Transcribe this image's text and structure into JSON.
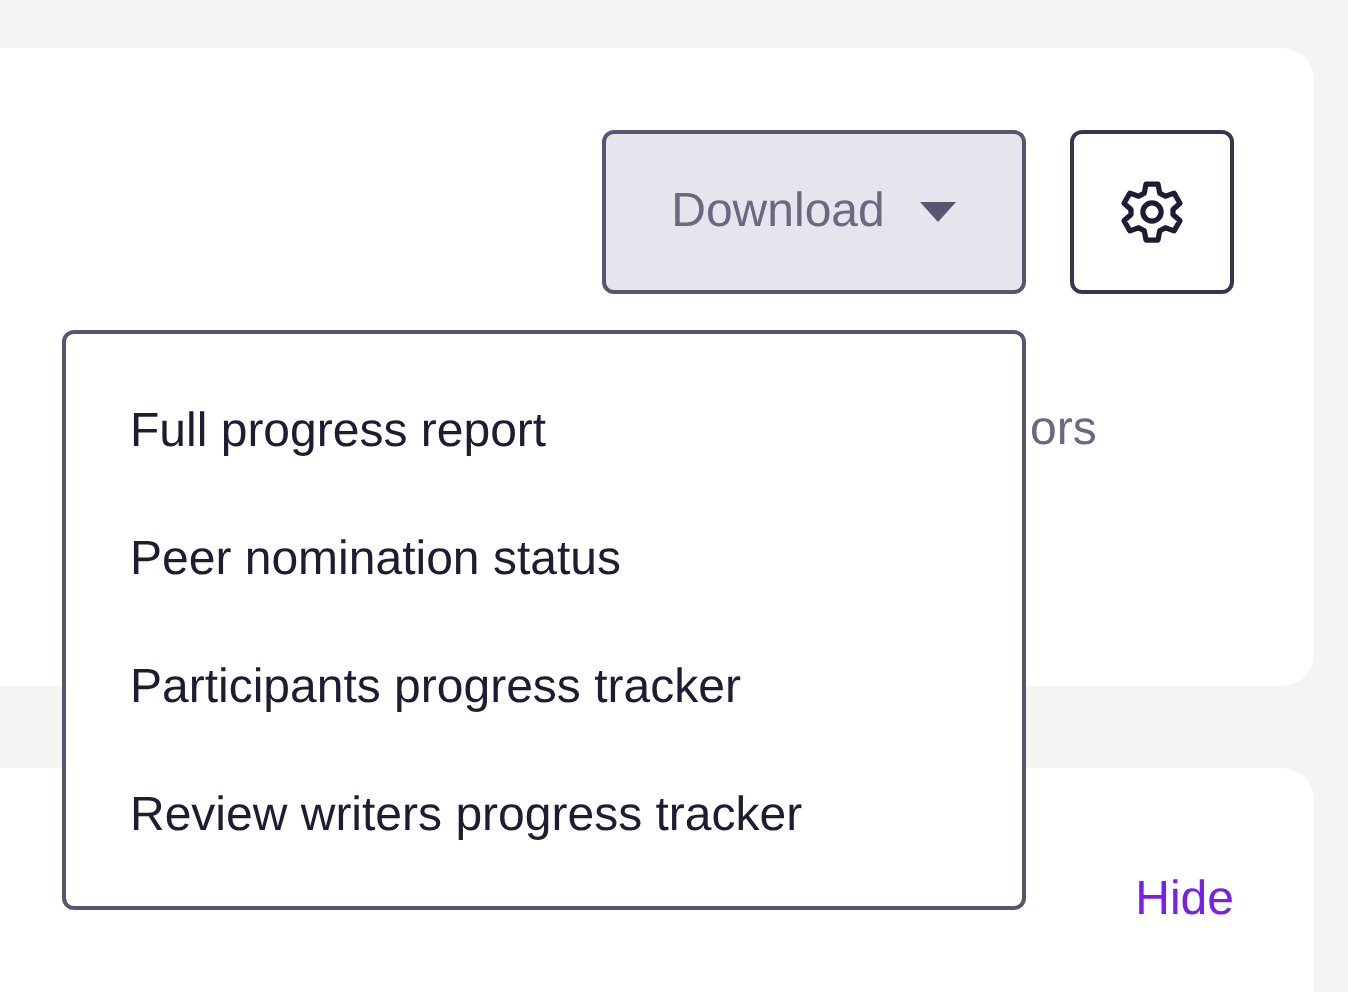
{
  "toolbar": {
    "download_button": {
      "label": "Download"
    }
  },
  "card_text": "ors",
  "download_menu": {
    "items": [
      {
        "label": "Full progress report"
      },
      {
        "label": "Peer nomination status"
      },
      {
        "label": "Participants progress tracker"
      },
      {
        "label": "Review writers progress tracker"
      }
    ]
  },
  "second_card": {
    "link": "Hide"
  }
}
